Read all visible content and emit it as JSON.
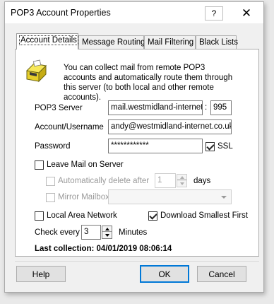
{
  "window": {
    "title": "POP3 Account Properties",
    "help_glyph": "?",
    "close_glyph": "✕"
  },
  "tabs": [
    {
      "label": "Account Details",
      "active": true
    },
    {
      "label": "Message Routing",
      "active": false
    },
    {
      "label": "Mail Filtering",
      "active": false
    },
    {
      "label": "Black Lists",
      "active": false
    }
  ],
  "info": {
    "icon": "mailbox-icon",
    "text": "You can collect mail from remote POP3 accounts and automatically route them through this server (to both local and other remote accounts)."
  },
  "fields": {
    "pop3_server": {
      "label": "POP3 Server",
      "value": "mail.westmidland-internet.co.uk",
      "port_separator": ":",
      "port": "995"
    },
    "account": {
      "label": "Account/Username",
      "value": "andy@westmidland-internet.co.uk"
    },
    "password": {
      "label": "Password",
      "value": "************",
      "ssl_label": "SSL",
      "ssl_checked": true
    }
  },
  "leave_mail": {
    "label": "Leave Mail on Server",
    "checked": false
  },
  "auto_delete": {
    "label": "Automatically delete after",
    "value": "1",
    "unit": "days",
    "enabled": false
  },
  "mirror": {
    "label": "Mirror Mailbox",
    "enabled": false
  },
  "lan": {
    "label": "Local Area Network",
    "checked": false
  },
  "download_smallest": {
    "label": "Download Smallest First",
    "checked": true
  },
  "check_every": {
    "label": "Check every",
    "value": "3",
    "unit": "Minutes"
  },
  "last_collection": "Last collection: 04/01/2019 08:06:14",
  "buttons": {
    "help": "Help",
    "ok": "OK",
    "cancel": "Cancel"
  }
}
